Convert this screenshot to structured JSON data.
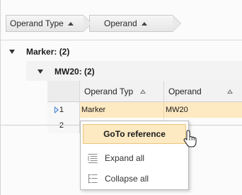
{
  "group_panel": {
    "chips": [
      {
        "label": "Operand Type",
        "sort": "ascending"
      },
      {
        "label": "Operand",
        "sort": "ascending"
      }
    ]
  },
  "tree": {
    "level1": {
      "label": "Marker: (2)",
      "expanded": true
    },
    "level2": {
      "label": "MW20: (2)",
      "expanded": true
    }
  },
  "grid": {
    "columns": [
      {
        "label": "Operand Typ",
        "sort": "ascending"
      },
      {
        "label": "Operand",
        "sort": "ascending"
      }
    ],
    "rows": [
      {
        "index": "1",
        "operand_type": "Marker",
        "operand": "MW20",
        "selected": true
      },
      {
        "index": "2",
        "operand_type": "",
        "operand": "",
        "selected": false
      }
    ]
  },
  "context_menu": {
    "items": [
      {
        "label": "GoTo reference",
        "highlighted": true
      },
      {
        "label": "Expand all",
        "icon": "expand-all-icon"
      },
      {
        "label": "Collapse all",
        "icon": "collapse-all-icon"
      }
    ]
  },
  "colors": {
    "selection": "#fde9c2",
    "selection_border": "#e8c77f",
    "row_pointer": "#3a7bd5"
  }
}
